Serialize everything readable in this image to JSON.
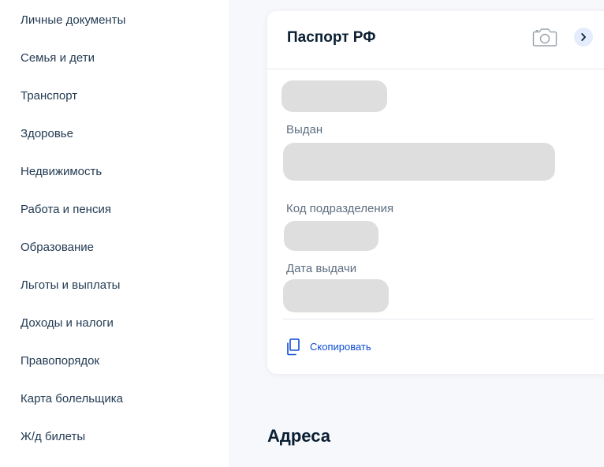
{
  "sidebar": {
    "items": [
      {
        "label": "Личные документы"
      },
      {
        "label": "Семья и дети"
      },
      {
        "label": "Транспорт"
      },
      {
        "label": "Здоровье"
      },
      {
        "label": "Недвижимость"
      },
      {
        "label": "Работа и пенсия"
      },
      {
        "label": "Образование"
      },
      {
        "label": "Льготы и выплаты"
      },
      {
        "label": "Доходы и налоги"
      },
      {
        "label": "Правопорядок"
      },
      {
        "label": "Карта болельщика"
      },
      {
        "label": "Ж/д билеты"
      }
    ]
  },
  "card": {
    "title": "Паспорт РФ",
    "icons": {
      "camera": "camera-icon",
      "chevron": "chevron-right-icon",
      "copy": "copy-icon"
    },
    "fields": {
      "issued_by_label": "Выдан",
      "division_code_label": "Код подразделения",
      "issue_date_label": "Дата выдачи"
    },
    "copy_label": "Скопировать"
  },
  "section": {
    "title": "Адреса"
  },
  "colors": {
    "link": "#0d4cd3",
    "text": "#0b1f33",
    "muted": "#5e6f80",
    "placeholder": "#dedede",
    "chevron_bg": "#e4ecfd"
  }
}
